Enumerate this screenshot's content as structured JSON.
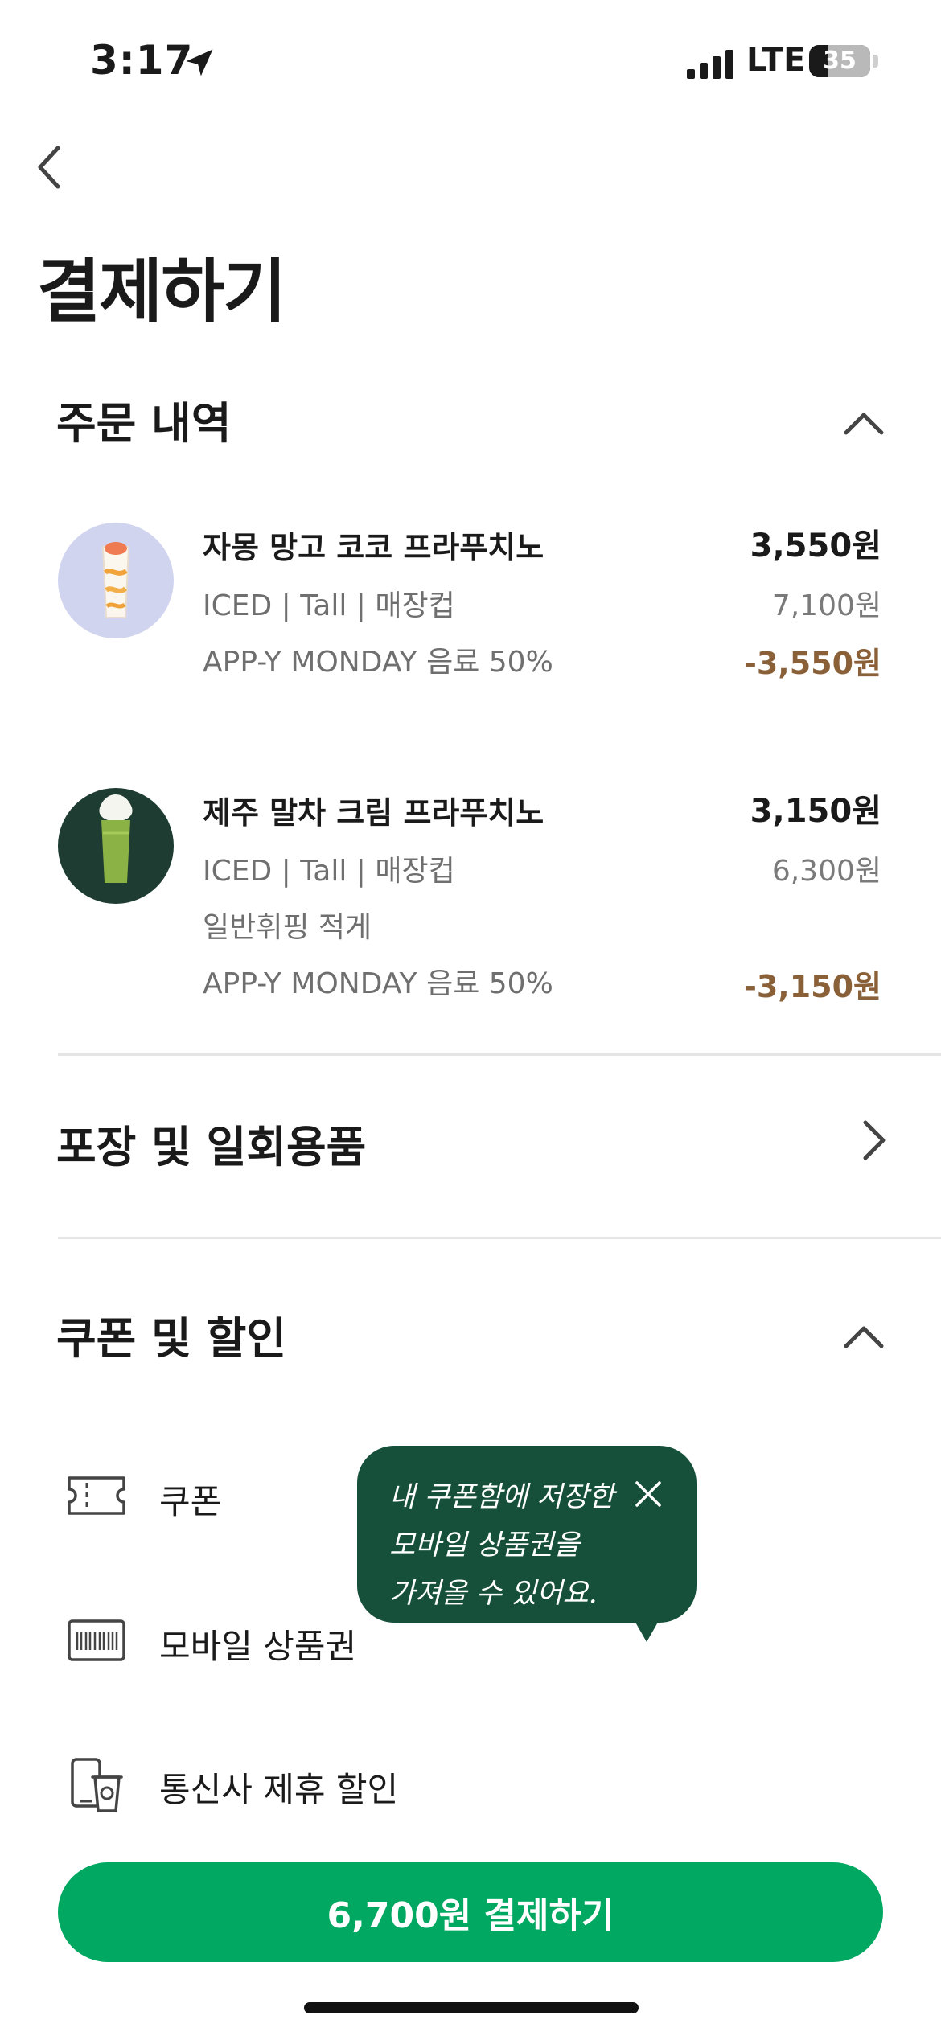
{
  "status_bar": {
    "time": "3:17",
    "network": "LTE",
    "battery": "35"
  },
  "page": {
    "title": "결제하기"
  },
  "order_section": {
    "title": "주문 내역",
    "items": [
      {
        "name": "자몽 망고 코코 프라푸치노",
        "options": [
          "ICED | Tall | 매장컵",
          "APP-Y MONDAY 음료 50%"
        ],
        "price": "3,550원",
        "original_price": "7,100원",
        "discount": "-3,550원"
      },
      {
        "name": "제주 말차 크림 프라푸치노",
        "options": [
          "ICED | Tall | 매장컵",
          "일반휘핑 적게",
          "APP-Y MONDAY 음료 50%"
        ],
        "price": "3,150원",
        "original_price": "6,300원",
        "discount": "-3,150원"
      }
    ]
  },
  "packaging_section": {
    "title": "포장 및 일회용품"
  },
  "coupon_section": {
    "title": "쿠폰 및 할인",
    "rows": [
      {
        "label": "쿠폰",
        "icon": "ticket-icon"
      },
      {
        "label": "모바일 상품권",
        "icon": "gift-card-barcode-icon"
      },
      {
        "label": "통신사 제휴 할인",
        "icon": "phone-cup-icon"
      }
    ]
  },
  "tooltip": {
    "lines": [
      "내 쿠폰함에 저장한",
      "모바일 상품권을",
      "가져올 수 있어요."
    ]
  },
  "pay_button": {
    "label": "6,700원 결제하기"
  },
  "colors": {
    "accent_green": "#00a862",
    "tooltip_green": "#16503b",
    "discount_brown": "#8a6038"
  }
}
